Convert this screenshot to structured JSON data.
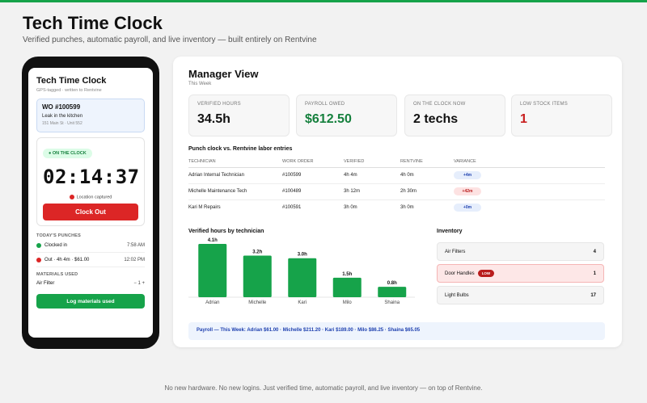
{
  "hero": {
    "title": "Tech Time Clock",
    "subtitle": "Verified punches, automatic payroll, and live inventory — built entirely on Rentvine"
  },
  "phone": {
    "title": "Tech Time Clock",
    "subtitle": "GPS-tagged · written to Rentvine",
    "work_order": {
      "number": "WO #100599",
      "description": "Leak in the kitchen",
      "address": "151 Main St · Unit 552"
    },
    "status_badge": "● ON THE CLOCK",
    "timer": "02:14:37",
    "location_text": "Location captured",
    "clock_out_label": "Clock Out",
    "punches_label": "TODAY'S PUNCHES",
    "punches": [
      {
        "label": "Clocked in",
        "time": "7:58 AM",
        "color": "#16a34a"
      },
      {
        "label": "Out · 4h 4m · $61.00",
        "time": "12:02 PM",
        "color": "#dc2626"
      }
    ],
    "materials_label": "MATERIALS USED",
    "material": {
      "name": "Air Filter",
      "stepper": "− 1 +"
    },
    "log_button_label": "Log materials used"
  },
  "manager": {
    "title": "Manager View",
    "period": "This Week",
    "stats": [
      {
        "label": "VERIFIED HOURS",
        "value": "34.5h",
        "color": "#111111"
      },
      {
        "label": "PAYROLL OWED",
        "value": "$612.50",
        "color": "#15803d"
      },
      {
        "label": "ON THE CLOCK NOW",
        "value": "2 techs",
        "color": "#111111"
      },
      {
        "label": "LOW STOCK ITEMS",
        "value": "1",
        "color": "#c81e1e"
      }
    ],
    "table_title": "Punch clock vs. Rentvine labor entries",
    "columns": [
      "TECHNICIAN",
      "WORK ORDER",
      "VERIFIED",
      "RENTVINE",
      "VARIANCE"
    ],
    "rows": [
      {
        "tech": "Adrian Internal Technician",
        "wo": "#100599",
        "verified": "4h 4m",
        "rentvine": "4h 0m",
        "variance": "+4m",
        "variance_type": "neutral"
      },
      {
        "tech": "Michelle Maintenance Tech",
        "wo": "#100489",
        "verified": "3h 12m",
        "rentvine": "2h 30m",
        "variance": "+42m",
        "variance_type": "bad"
      },
      {
        "tech": "Kari M Repairs",
        "wo": "#100591",
        "verified": "3h 0m",
        "rentvine": "3h 0m",
        "variance": "+0m",
        "variance_type": "neutral"
      }
    ],
    "inventory_title": "Inventory",
    "inventory": [
      {
        "name": "Air Filters",
        "qty": "4",
        "low": false
      },
      {
        "name": "Door Handles",
        "qty": "1",
        "low": true,
        "badge": "LOW"
      },
      {
        "name": "Light Bulbs",
        "qty": "17",
        "low": false
      }
    ],
    "payroll_text": "Payroll — This Week: Adrian $61.00 · Michelle $211.20 · Kari $189.00 · Milo $86.25 · Shaina $65.05"
  },
  "chart_data": {
    "type": "bar",
    "title": "Verified hours by technician",
    "categories": [
      "Adrian",
      "Michelle",
      "Kari",
      "Milo",
      "Shaina"
    ],
    "values": [
      4.1,
      3.2,
      3.0,
      1.5,
      0.8
    ],
    "value_labels": [
      "4.1h",
      "3.2h",
      "3.0h",
      "1.5h",
      "0.8h"
    ],
    "ylim": [
      0,
      4.1
    ],
    "color": "#16a34a",
    "grid": false
  },
  "footer": "No new hardware. No new logins. Just verified time, automatic payroll, and live inventory — on top of Rentvine."
}
